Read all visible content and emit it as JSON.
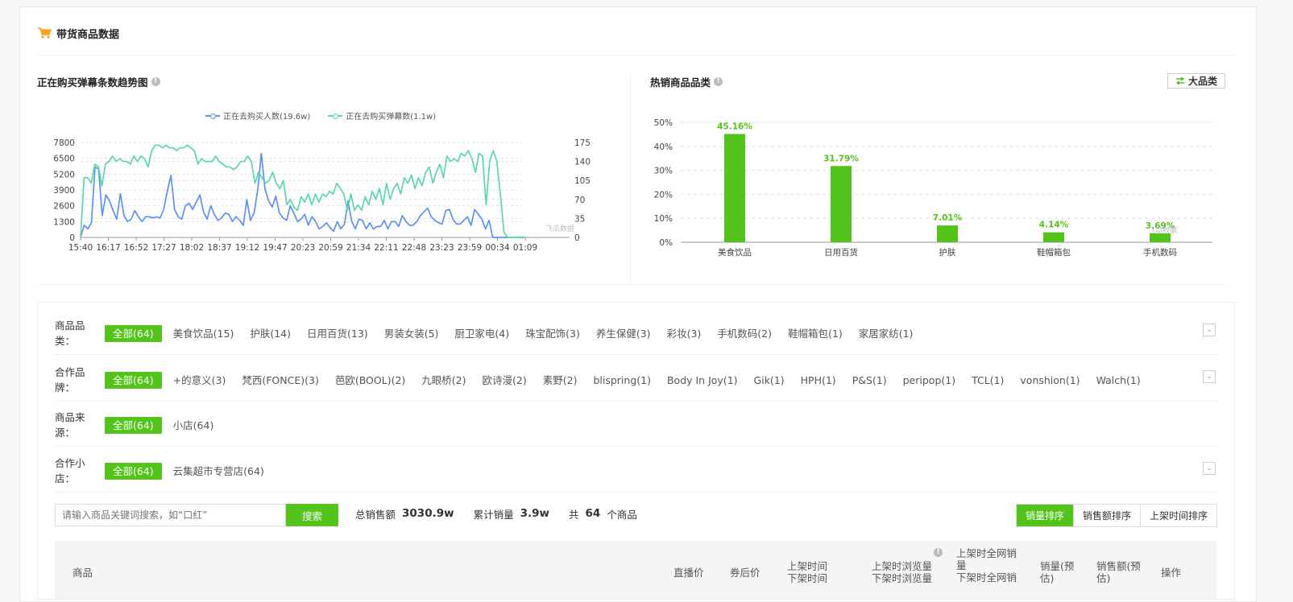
{
  "section": {
    "title": "带货商品数据"
  },
  "trend": {
    "title": "正在购买弹幕条数趋势图",
    "legend": [
      "正在去购买人数(19.6w)",
      "正在去购买弹幕数(1.1w)"
    ],
    "watermark": "飞瓜数据",
    "chart_data": {
      "type": "line",
      "x_ticks": [
        "15:40",
        "16:17",
        "16:52",
        "17:27",
        "18:02",
        "18:37",
        "19:12",
        "19:47",
        "20:23",
        "20:59",
        "21:34",
        "22:11",
        "22:48",
        "23:23",
        "23:59",
        "00:34",
        "01:09"
      ],
      "y_left_ticks": [
        "0",
        "1300",
        "2600",
        "3900",
        "5200",
        "6500",
        "7800"
      ],
      "y_right_ticks": [
        "0",
        "35",
        "70",
        "105",
        "140",
        "175"
      ],
      "y_left_range": [
        0,
        7800
      ],
      "y_right_range": [
        0,
        175
      ],
      "series": [
        {
          "name": "正在去购买人数(19.6w)",
          "axis": "left",
          "color": "#5b8ff9",
          "values": [
            0,
            1000,
            700,
            1200,
            5800,
            5600,
            1800,
            3500,
            3000,
            2200,
            1500,
            3600,
            1800,
            1300,
            1500,
            2200,
            1700,
            1300,
            1700,
            1700,
            1600,
            1700,
            1600,
            2300,
            3800,
            5100,
            2300,
            1700,
            1500,
            2600,
            2800,
            2300,
            2900,
            3500,
            2100,
            1500,
            2600,
            1900,
            1400,
            1600,
            2000,
            1900,
            1300,
            1700,
            1400,
            1000,
            3100,
            1400,
            2000,
            3900,
            6900,
            4000,
            3000,
            2500,
            3400,
            2000,
            1600,
            1400,
            2600,
            2000,
            1300,
            1500,
            1900,
            1000,
            1700,
            1300,
            700,
            900,
            1200,
            800,
            500,
            1300,
            700,
            1100,
            3000,
            1300,
            700,
            1500,
            1400,
            700,
            1200,
            700,
            900,
            900,
            1400,
            700,
            1300,
            1300,
            900,
            1800,
            1300,
            1000,
            1000,
            1300,
            1800,
            2100,
            2400,
            1700,
            1400,
            1200,
            1100,
            2200,
            2300,
            1500,
            1100,
            1100,
            1400,
            1700,
            1000,
            2300,
            1900,
            1500,
            700,
            1400,
            0,
            0,
            0,
            0,
            0,
            0,
            0,
            0,
            0,
            0
          ]
        },
        {
          "name": "正在去购买弹幕数(1.1w)",
          "axis": "right",
          "color": "#5ad8a6",
          "values": [
            0,
            110,
            110,
            100,
            135,
            130,
            95,
            135,
            140,
            150,
            140,
            145,
            140,
            140,
            135,
            150,
            140,
            150,
            145,
            130,
            160,
            170,
            170,
            165,
            170,
            165,
            165,
            160,
            165,
            165,
            170,
            165,
            160,
            135,
            145,
            140,
            140,
            140,
            150,
            140,
            135,
            130,
            130,
            125,
            130,
            140,
            140,
            150,
            140,
            100,
            120,
            110,
            100,
            105,
            120,
            100,
            90,
            105,
            60,
            70,
            55,
            50,
            75,
            65,
            80,
            60,
            80,
            65,
            80,
            75,
            85,
            80,
            100,
            90,
            80,
            50,
            80,
            50,
            60,
            50,
            75,
            60,
            85,
            70,
            90,
            60,
            100,
            70,
            90,
            100,
            80,
            110,
            100,
            115,
            90,
            110,
            95,
            120,
            130,
            100,
            120,
            135,
            110,
            150,
            140,
            145,
            140,
            155,
            150,
            160,
            145,
            120,
            155,
            150,
            60,
            140,
            160,
            140,
            80,
            10,
            0,
            0,
            0,
            0,
            0,
            0
          ]
        }
      ]
    }
  },
  "categories": {
    "title": "热销商品品类",
    "toggle_label": "大品类",
    "watermark": "飞瓜数据",
    "chart_data": {
      "type": "bar",
      "categories": [
        "美食饮品",
        "日用百货",
        "护肤",
        "鞋帽箱包",
        "手机数码"
      ],
      "values": [
        45.16,
        31.79,
        7.01,
        4.14,
        3.69
      ],
      "value_labels": [
        "45.16%",
        "31.79%",
        "7.01%",
        "4.14%",
        "3.69%"
      ],
      "y_ticks": [
        "0%",
        "10%",
        "20%",
        "30%",
        "40%",
        "50%"
      ],
      "ylim": [
        0,
        50
      ],
      "color": "#52c41a"
    }
  },
  "filters": {
    "category": {
      "label": "商品品类：",
      "options": [
        "全部(64)",
        "美食饮品(15)",
        "护肤(14)",
        "日用百货(13)",
        "男装女装(5)",
        "厨卫家电(4)",
        "珠宝配饰(3)",
        "养生保健(3)",
        "彩妆(3)",
        "手机数码(2)",
        "鞋帽箱包(1)",
        "家居家纺(1)"
      ]
    },
    "brand": {
      "label": "合作品牌：",
      "options": [
        "全部(64)",
        "+的意义(3)",
        "梵西(FONCE)(3)",
        "芭欧(BOOL)(2)",
        "九眼桥(2)",
        "欧诗漫(2)",
        "素野(2)",
        "blispring(1)",
        "Body In Joy(1)",
        "Gik(1)",
        "HPH(1)",
        "P&S(1)",
        "peripop(1)",
        "TCL(1)",
        "vonshion(1)",
        "Walch(1)"
      ]
    },
    "source": {
      "label": "商品来源：",
      "options": [
        "全部(64)",
        "小店(64)"
      ]
    },
    "shop": {
      "label": "合作小店：",
      "options": [
        "全部(64)",
        "云集超市专营店(64)"
      ]
    }
  },
  "search": {
    "placeholder": "请输入商品关键词搜索，如“口红”",
    "button": "搜索"
  },
  "stats": {
    "total_sales_label": "总销售额",
    "total_sales": "3030.9w",
    "volume_label": "累计销量",
    "volume": "3.9w",
    "count_prefix": "共",
    "count": "64",
    "count_suffix": "个商品"
  },
  "sort": [
    "销量排序",
    "销售额排序",
    "上架时间排序"
  ],
  "table": {
    "headers": {
      "product": "商品",
      "live_price": "直播价",
      "coupon_price": "券后价",
      "time": [
        "上架时间",
        "下架时间"
      ],
      "views": [
        "上架时浏览量",
        "下架时浏览量"
      ],
      "web_sales": [
        "上架时全网销",
        "量",
        "下架时全网销"
      ],
      "sales": [
        "销量(预",
        "估)"
      ],
      "revenue": [
        "销售额(预",
        "估)"
      ],
      "action": "操作"
    }
  }
}
